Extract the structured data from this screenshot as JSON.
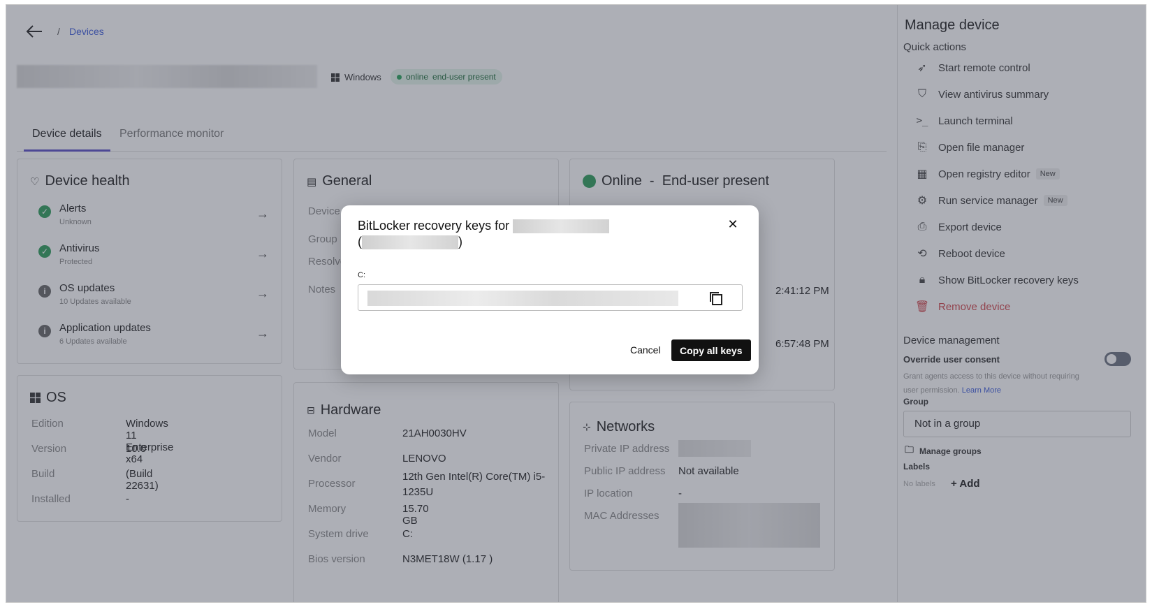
{
  "breadcrumb": {
    "separator": "/",
    "link": "Devices"
  },
  "device": {
    "os": "Windows",
    "status_online": "online",
    "status_user": "end-user present"
  },
  "tabs": [
    {
      "label": "Device details"
    },
    {
      "label": "Performance monitor"
    }
  ],
  "health": {
    "title": "Device health",
    "items": [
      {
        "label": "Alerts",
        "sub": "Unknown",
        "state": "ok"
      },
      {
        "label": "Antivirus",
        "sub": "Protected",
        "state": "ok"
      },
      {
        "label": "OS updates",
        "sub": "10 Updates available",
        "state": "info"
      },
      {
        "label": "Application updates",
        "sub": "6 Updates available",
        "state": "info"
      }
    ]
  },
  "general": {
    "title": "General",
    "fields": [
      "Device",
      "Group",
      "Resolve",
      "Notes"
    ]
  },
  "status_card": {
    "title": "Online  -  End-user present",
    "time1": "2:41:12 PM",
    "time2": "6:57:48 PM"
  },
  "os": {
    "title": "OS",
    "rows": [
      {
        "k": "Edition",
        "v": "Windows 11 Enterprise x64"
      },
      {
        "k": "Version",
        "v": "10.0"
      },
      {
        "k": "Build",
        "v": "(Build 22631)"
      },
      {
        "k": "Installed",
        "v": "-"
      }
    ]
  },
  "hardware": {
    "title": "Hardware",
    "rows": [
      {
        "k": "Model",
        "v": "21AH0030HV"
      },
      {
        "k": "Vendor",
        "v": "LENOVO"
      },
      {
        "k": "Processor",
        "v": "12th Gen Intel(R) Core(TM) i5-1235U"
      },
      {
        "k": "Memory",
        "v": "15.70 GB"
      },
      {
        "k": "System drive",
        "v": "C:"
      },
      {
        "k": "Bios version",
        "v": "N3MET18W (1.17 )"
      }
    ]
  },
  "networks": {
    "title": "Networks",
    "rows": [
      {
        "k": "Private IP address",
        "v": ""
      },
      {
        "k": "Public IP address",
        "v": "Not available"
      },
      {
        "k": "IP location",
        "v": "-"
      },
      {
        "k": "MAC Addresses",
        "v": ""
      }
    ]
  },
  "side": {
    "title": "Manage device",
    "quick_actions": "Quick actions",
    "actions": [
      {
        "label": "Start remote control",
        "icon": "cursor-icon"
      },
      {
        "label": "View antivirus summary",
        "icon": "shield-icon"
      },
      {
        "label": "Launch terminal",
        "icon": "terminal-icon"
      },
      {
        "label": "Open file manager",
        "icon": "file-manager-icon"
      },
      {
        "label": "Open registry editor",
        "icon": "registry-icon",
        "badge": "New"
      },
      {
        "label": "Run service manager",
        "icon": "service-icon",
        "badge": "New"
      },
      {
        "label": "Export device",
        "icon": "export-icon"
      },
      {
        "label": "Reboot device",
        "icon": "reboot-icon"
      },
      {
        "label": "Show BitLocker recovery keys",
        "icon": "lock-icon"
      },
      {
        "label": "Remove device",
        "icon": "trash-icon"
      }
    ],
    "device_management": "Device management",
    "override_title": "Override user consent",
    "override_desc": "Grant agents access to this device without requiring user permission.",
    "learn_more": "Learn More",
    "group_label": "Group",
    "group_value": "Not in a group",
    "manage_groups": "Manage groups",
    "labels_label": "Labels",
    "no_labels": "No labels",
    "add": "+ Add"
  },
  "modal": {
    "title_prefix": "BitLocker recovery keys for",
    "drive": "C:",
    "cancel": "Cancel",
    "copy_all": "Copy all keys",
    "close": "✕"
  }
}
